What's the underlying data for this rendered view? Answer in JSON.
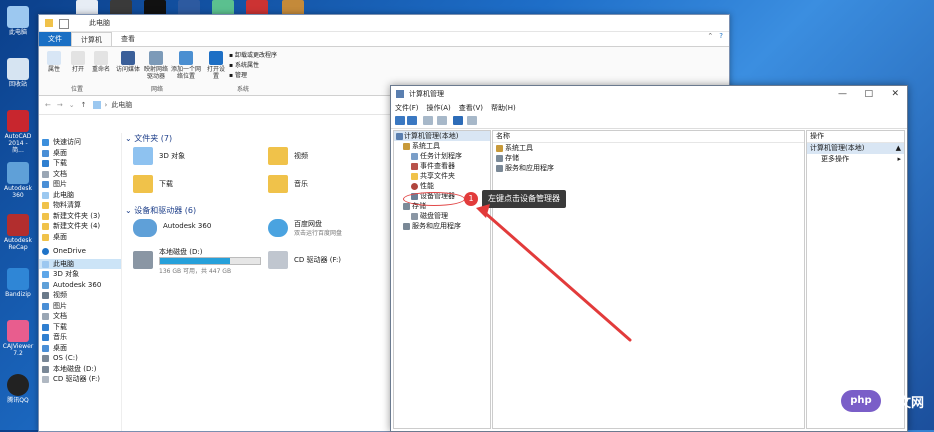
{
  "desktop": {
    "icons": [
      {
        "label": "此电脑"
      },
      {
        "label": "回收站"
      },
      {
        "label": "AutoCAD 2014 - 简..."
      },
      {
        "label": "Autodesk 360"
      },
      {
        "label": "Autodesk ReCap"
      },
      {
        "label": "Bandizip"
      },
      {
        "label": "CAJViewer 7.2"
      },
      {
        "label": "腾讯QQ"
      }
    ]
  },
  "explorer": {
    "title": "此电脑",
    "tabs": {
      "file": "文件",
      "computer": "计算机",
      "view": "查看"
    },
    "ribbon": {
      "properties": "属性",
      "open": "打开",
      "rename": "重命名",
      "access_media": "访问媒体",
      "map_drive": "映射网络驱动器",
      "add_location": "添加一个网络位置",
      "open_settings": "打开设置",
      "uninstall": "卸载或更改程序",
      "system_props": "系统属性",
      "manage": "管理",
      "group_location": "位置",
      "group_network": "网络",
      "group_system": "系统"
    },
    "address": "此电脑",
    "nav": {
      "quick_access": "快速访问",
      "items": [
        "桌面",
        "下载",
        "文档",
        "图片",
        "此电脑",
        "物料清算",
        "新建文件夹 (3)",
        "新建文件夹 (4)",
        "桌面"
      ],
      "onedrive": "OneDrive",
      "this_pc": "此电脑",
      "pc_items": [
        "3D 对象",
        "Autodesk 360",
        "视频",
        "图片",
        "文档",
        "下载",
        "音乐",
        "桌面",
        "OS (C:)",
        "本地磁盘 (D:)",
        "CD 驱动器 (F:)"
      ]
    },
    "folders_header": "文件夹 (7)",
    "folders": [
      "3D 对象",
      "视频",
      "下载",
      "音乐"
    ],
    "devices_header": "设备和驱动器 (6)",
    "devices": {
      "a360": "Autodesk 360",
      "baidu": "百度网盘",
      "baidu_sub": "双击运行百度网盘",
      "diskd": "本地磁盘 (D:)",
      "diskd_space": "136 GB 可用，共 447 GB",
      "diskd_used": 0.7,
      "cd": "CD 驱动器 (F:)"
    }
  },
  "compmgmt": {
    "title": "计算机管理",
    "menu": [
      "文件(F)",
      "操作(A)",
      "查看(V)",
      "帮助(H)"
    ],
    "tree": {
      "root": "计算机管理(本地)",
      "system_tools": "系统工具",
      "task_scheduler": "任务计划程序",
      "event_viewer": "事件查看器",
      "shared_folders": "共享文件夹",
      "performance": "性能",
      "device_manager": "设备管理器",
      "storage": "存储",
      "disk_mgmt": "磁盘管理",
      "services": "服务和应用程序"
    },
    "list_header": "名称",
    "list": [
      "系统工具",
      "存储",
      "服务和应用程序"
    ],
    "actions_header": "操作",
    "actions_sel": "计算机管理(本地)",
    "actions_more": "更多操作"
  },
  "annotation": {
    "badge": "1",
    "text": "左键点击设备管理器"
  },
  "watermark": {
    "logo": "php",
    "site": "中文网"
  }
}
